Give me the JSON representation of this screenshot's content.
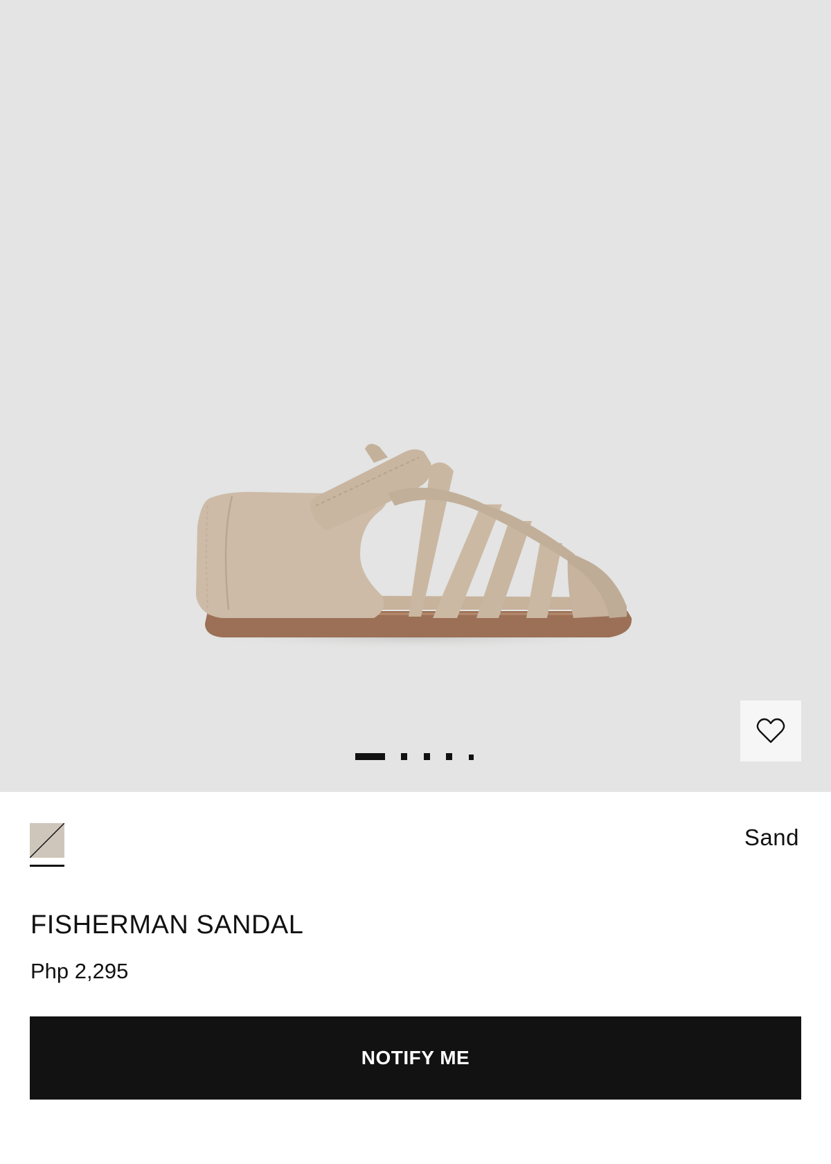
{
  "gallery": {
    "image_subject": "sand suede fisherman sandal",
    "slide_count": 5,
    "active_slide": 1,
    "background_color": "#e3e4e3"
  },
  "wishlist": {
    "icon": "heart-outline-icon"
  },
  "color": {
    "swatch_color": "#cfc6bb",
    "selected_name": "Sand"
  },
  "product": {
    "name": "FISHERMAN SANDAL",
    "price": "Php 2,295"
  },
  "actions": {
    "notify_label": "NOTIFY ME",
    "button_color": "#121212"
  }
}
